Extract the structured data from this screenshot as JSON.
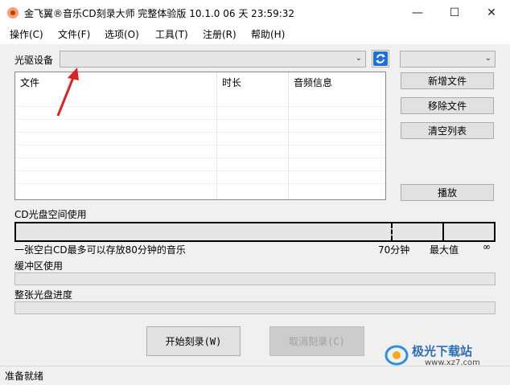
{
  "window": {
    "title": "金飞翼®音乐CD刻录大师 完整体验版 10.1.0 06 天 23:59:32",
    "minimize": "—",
    "maximize": "☐",
    "close": "✕"
  },
  "menu": [
    "操作(C)",
    "文件(F)",
    "选项(O)",
    "工具(T)",
    "注册(R)",
    "帮助(H)"
  ],
  "drive": {
    "label": "光驱设备",
    "value": "",
    "refresh_icon": "refresh-icon"
  },
  "speed_select": {
    "value": ""
  },
  "file_list": {
    "columns": [
      "文件",
      "时长",
      "音频信息"
    ],
    "rows": []
  },
  "side_buttons": {
    "add": "新增文件",
    "remove": "移除文件",
    "clear": "清空列表",
    "play": "播放"
  },
  "cd_usage": {
    "label": "CD光盘空间使用",
    "info": "一张空白CD最多可以存放80分钟的音乐",
    "mark_70": "70分钟",
    "mark_max": "最大值",
    "mark_inf": "∞",
    "used_fraction": 0
  },
  "buffer": {
    "label": "缓冲区使用",
    "fraction": 0
  },
  "disc_progress": {
    "label": "整张光盘进度",
    "fraction": 0
  },
  "actions": {
    "start": "开始刻录(W)",
    "cancel": "取消刻录(C)"
  },
  "status": "准备就绪",
  "watermark": {
    "name": "极光下载站",
    "url": "www.xz7.com"
  },
  "colors": {
    "annotation_arrow": "#e02020",
    "refresh_blue": "#1e6fd9"
  }
}
